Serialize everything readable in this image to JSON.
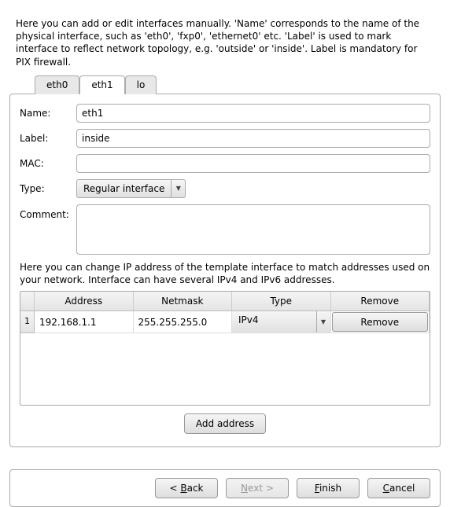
{
  "intro_text": "Here you can add or edit interfaces manually. 'Name' corresponds to the name of the physical interface, such as 'eth0', 'fxp0', 'ethernet0' etc. 'Label' is used to mark interface to reflect network topology, e.g. 'outside' or 'inside'. Label is mandatory for PIX firewall.",
  "tabs": {
    "items": [
      {
        "label": "eth0",
        "active": false
      },
      {
        "label": "eth1",
        "active": true
      },
      {
        "label": "lo",
        "active": false
      }
    ]
  },
  "form": {
    "name": {
      "label": "Name:",
      "value": "eth1"
    },
    "label": {
      "label": "Label:",
      "value": "inside"
    },
    "mac": {
      "label": "MAC:",
      "value": ""
    },
    "type": {
      "label": "Type:",
      "value": "Regular interface"
    },
    "comment": {
      "label": "Comment:",
      "value": ""
    }
  },
  "ip_intro": "Here you can change IP address of the template interface to match addresses used on your network. Interface can have several IPv4 and IPv6 addresses.",
  "table": {
    "headers": {
      "address": "Address",
      "netmask": "Netmask",
      "type": "Type",
      "remove": "Remove"
    },
    "rows": [
      {
        "num": "1",
        "address": "192.168.1.1",
        "netmask": "255.255.255.0",
        "type": "IPv4",
        "remove_label": "Remove"
      }
    ]
  },
  "buttons": {
    "add_address": "Add address",
    "back": {
      "arrow": "<",
      "pre": "",
      "mn": "B",
      "post": "ack"
    },
    "next": {
      "pre": "",
      "mn": "N",
      "post": "ext",
      "arrow": ">"
    },
    "finish": {
      "pre": "",
      "mn": "F",
      "post": "inish"
    },
    "cancel": {
      "pre": "",
      "mn": "C",
      "post": "ancel"
    }
  }
}
